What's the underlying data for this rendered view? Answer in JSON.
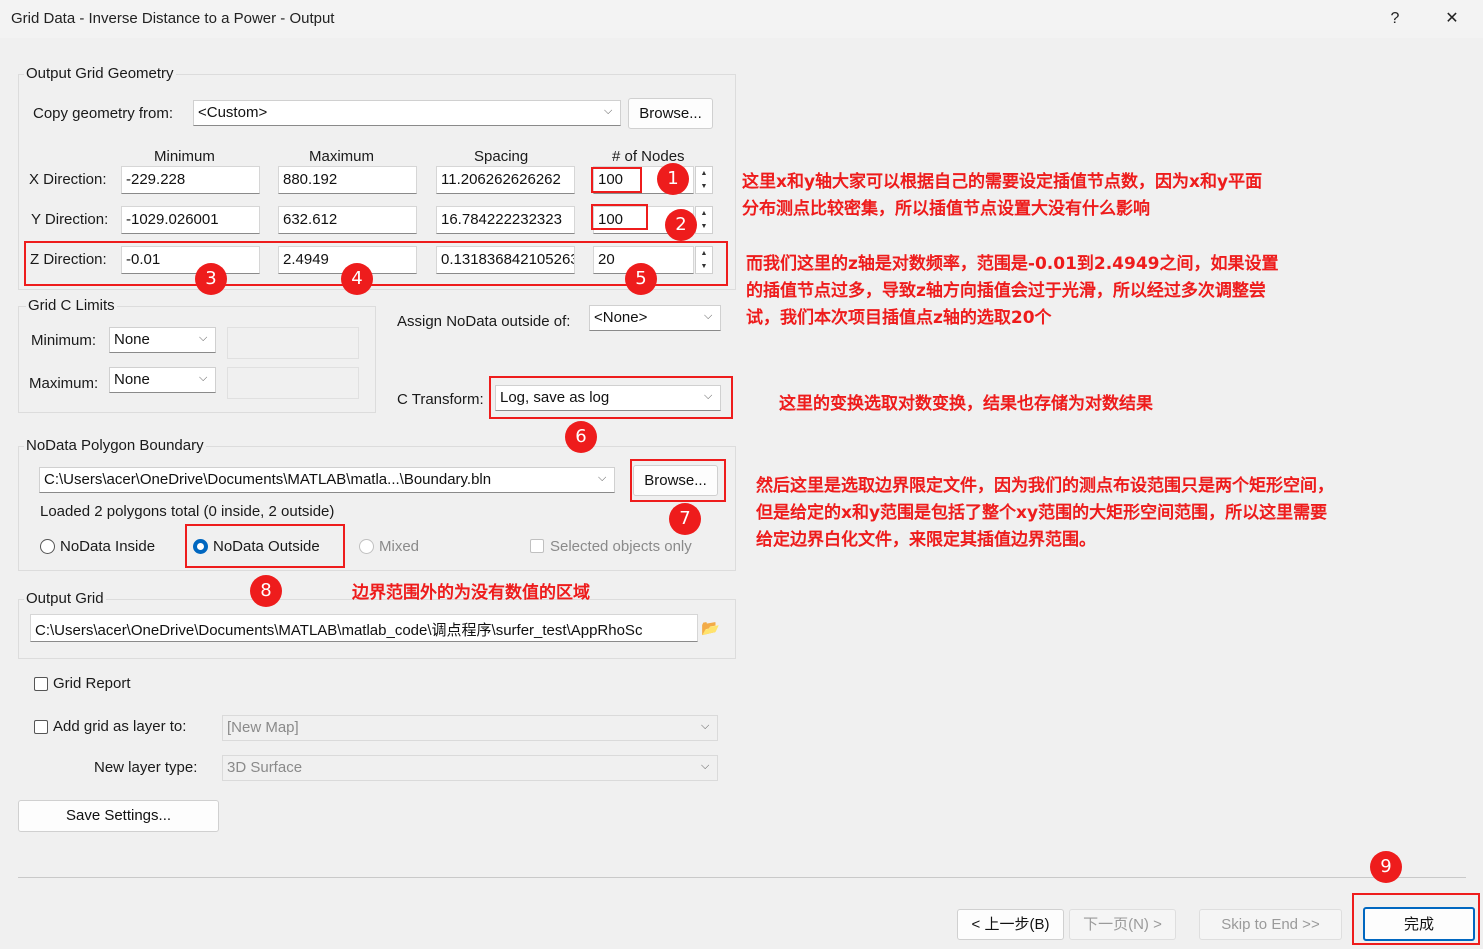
{
  "window": {
    "title": "Grid Data - Inverse Distance to a Power - Output",
    "help": "?",
    "close": "✕"
  },
  "geometry": {
    "group": "Output Grid Geometry",
    "copy_label": "Copy geometry from:",
    "copy_value": "<Custom>",
    "browse": "Browse...",
    "col_min": "Minimum",
    "col_max": "Maximum",
    "col_spacing": "Spacing",
    "col_nodes": "# of Nodes",
    "rows": [
      {
        "label": "X Direction:",
        "min": "-229.228",
        "max": "880.192",
        "spacing": "11.206262626262",
        "nodes": "100"
      },
      {
        "label": "Y Direction:",
        "min": "-1029.026001",
        "max": "632.612",
        "spacing": "16.784222232323",
        "nodes": "100"
      },
      {
        "label": "Z Direction:",
        "min": "-0.01",
        "max": "2.4949",
        "spacing": "0.131836842105263",
        "nodes": "20"
      }
    ]
  },
  "limits": {
    "group": "Grid C Limits",
    "min_label": "Minimum:",
    "min_value": "None",
    "max_label": "Maximum:",
    "max_value": "None"
  },
  "assign": {
    "label": "Assign NoData outside of:",
    "value": "<None>"
  },
  "transform": {
    "label": "C Transform:",
    "value": "Log, save as log"
  },
  "polygon": {
    "group": "NoData Polygon Boundary",
    "path": "C:\\Users\\acer\\OneDrive\\Documents\\MATLAB\\matla...\\Boundary.bln",
    "browse": "Browse...",
    "status": "Loaded 2 polygons total (0 inside, 2 outside)",
    "opt_inside": "NoData Inside",
    "opt_outside": "NoData Outside",
    "opt_mixed": "Mixed",
    "selected_only": "Selected objects only"
  },
  "output": {
    "group": "Output Grid",
    "path": "C:\\Users\\acer\\OneDrive\\Documents\\MATLAB\\matlab_code\\调点程序\\surfer_test\\AppRhoSc"
  },
  "report": {
    "label": "Grid Report"
  },
  "layer": {
    "add_label": "Add grid as layer to:",
    "add_value": "[New Map]",
    "type_label": "New layer type:",
    "type_value": "3D Surface"
  },
  "save_settings": "Save Settings...",
  "nav": {
    "back": "< 上一步(B)",
    "next": "下一页(N) >",
    "skip": "Skip to End >>",
    "finish": "完成"
  },
  "badges": [
    "1",
    "2",
    "3",
    "4",
    "5",
    "6",
    "7",
    "8",
    "9"
  ],
  "annotations": {
    "a1_l1": "这里x和y轴大家可以根据自己的需要设定插值节点数，因为x和y平面",
    "a1_l2": "分布测点比较密集，所以插值节点设置大没有什么影响",
    "a2_l1": "而我们这里的z轴是对数频率，范围是-0.01到2.4949之间，如果设置",
    "a2_l2": "的插值节点过多，导致z轴方向插值会过于光滑，所以经过多次调整尝",
    "a2_l3": "试，我们本次项目插值点z轴的选取20个",
    "a3": "这里的变换选取对数变换，结果也存储为对数结果",
    "a4_l1": "然后这里是选取边界限定文件，因为我们的测点布设范围只是两个矩形空间，",
    "a4_l2": "但是给定的x和y范围是包括了整个xy范围的大矩形空间范围，所以这里需要",
    "a4_l3": "给定边界白化文件，来限定其插值边界范围。",
    "a5": "边界范围外的为没有数值的区域"
  },
  "colors": {
    "annotation": "#ee1c1c",
    "radio_accent": "#0067c0"
  }
}
